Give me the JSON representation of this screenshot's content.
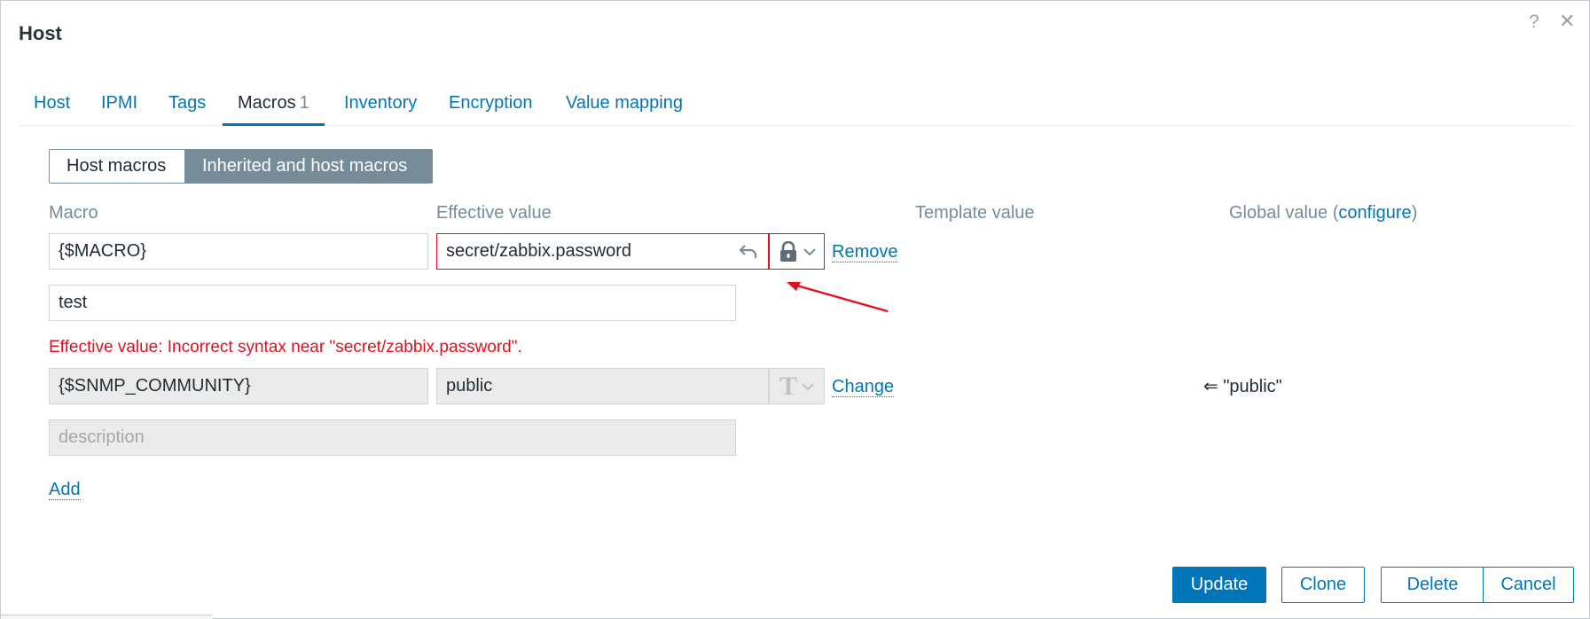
{
  "dialog": {
    "title": "Host"
  },
  "tabs": [
    {
      "label": "Host"
    },
    {
      "label": "IPMI"
    },
    {
      "label": "Tags"
    },
    {
      "label": "Macros",
      "count": "1"
    },
    {
      "label": "Inventory"
    },
    {
      "label": "Encryption"
    },
    {
      "label": "Value mapping"
    }
  ],
  "macro_mode": {
    "host": "Host macros",
    "inherited": "Inherited and host macros"
  },
  "columns": {
    "macro": "Macro",
    "effective": "Effective value",
    "template": "Template value",
    "global_prefix": "Global value (",
    "global_link": "configure",
    "global_suffix": ")"
  },
  "rows": [
    {
      "macro": "{$MACRO}",
      "value": "secret/zabbix.password",
      "description": "test",
      "action": "Remove",
      "error": "Effective value: Incorrect syntax near \"secret/zabbix.password\"."
    },
    {
      "macro": "{$SNMP_COMMUNITY}",
      "value": "public",
      "description_placeholder": "description",
      "action": "Change",
      "global_value": "⇐ \"public\""
    }
  ],
  "add_label": "Add",
  "buttons": {
    "update": "Update",
    "clone": "Clone",
    "delete": "Delete",
    "cancel": "Cancel"
  },
  "colors": {
    "accent": "#0275b8",
    "error": "#e0101e",
    "muted": "#768d99"
  }
}
